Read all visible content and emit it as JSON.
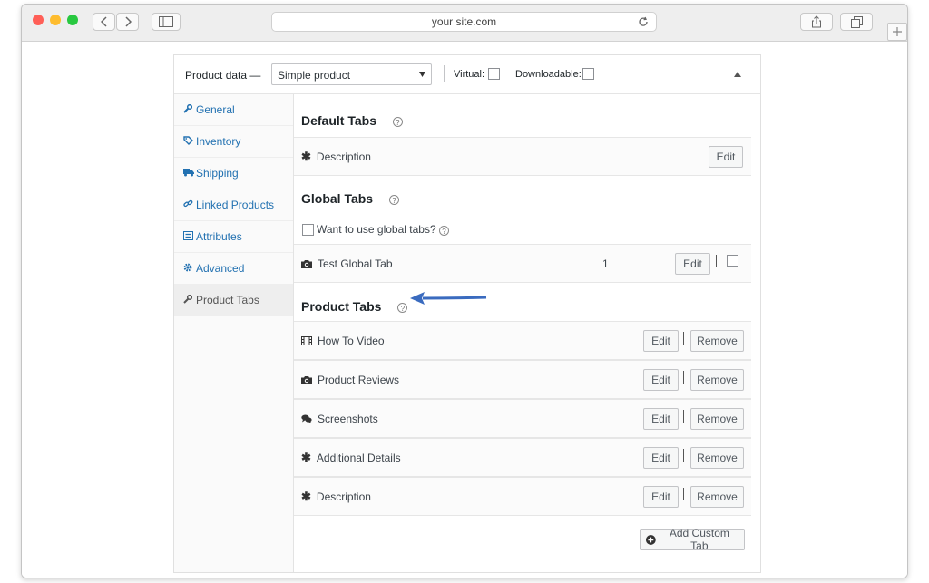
{
  "browser": {
    "url": "your site.com"
  },
  "product_data": {
    "label": "Product data —",
    "type_value": "Simple product",
    "virtual_label": "Virtual:",
    "downloadable_label": "Downloadable:"
  },
  "sidebar": {
    "items": [
      {
        "label": "General",
        "icon": "wrench-icon"
      },
      {
        "label": "Inventory",
        "icon": "tag-icon"
      },
      {
        "label": "Shipping",
        "icon": "truck-icon"
      },
      {
        "label": "Linked Products",
        "icon": "link-icon"
      },
      {
        "label": "Attributes",
        "icon": "list-icon"
      },
      {
        "label": "Advanced",
        "icon": "gear-icon"
      },
      {
        "label": "Product Tabs",
        "icon": "wrench-icon"
      }
    ]
  },
  "default_tabs": {
    "title": "Default Tabs",
    "rows": [
      {
        "label": "Description",
        "edit": "Edit"
      }
    ]
  },
  "global_tabs": {
    "title": "Global Tabs",
    "checkbox_label": "Want to use global tabs?",
    "rows": [
      {
        "label": "Test Global Tab",
        "count": "1",
        "edit": "Edit"
      }
    ]
  },
  "product_tabs": {
    "title": "Product Tabs",
    "rows": [
      {
        "label": "How To Video",
        "edit": "Edit",
        "remove": "Remove"
      },
      {
        "label": "Product Reviews",
        "edit": "Edit",
        "remove": "Remove"
      },
      {
        "label": "Screenshots",
        "edit": "Edit",
        "remove": "Remove"
      },
      {
        "label": "Additional Details",
        "edit": "Edit",
        "remove": "Remove"
      },
      {
        "label": "Description",
        "edit": "Edit",
        "remove": "Remove"
      }
    ],
    "add_button": "Add Custom Tab"
  },
  "colors": {
    "link": "#2271b1",
    "arrow": "#3a6bbf"
  }
}
